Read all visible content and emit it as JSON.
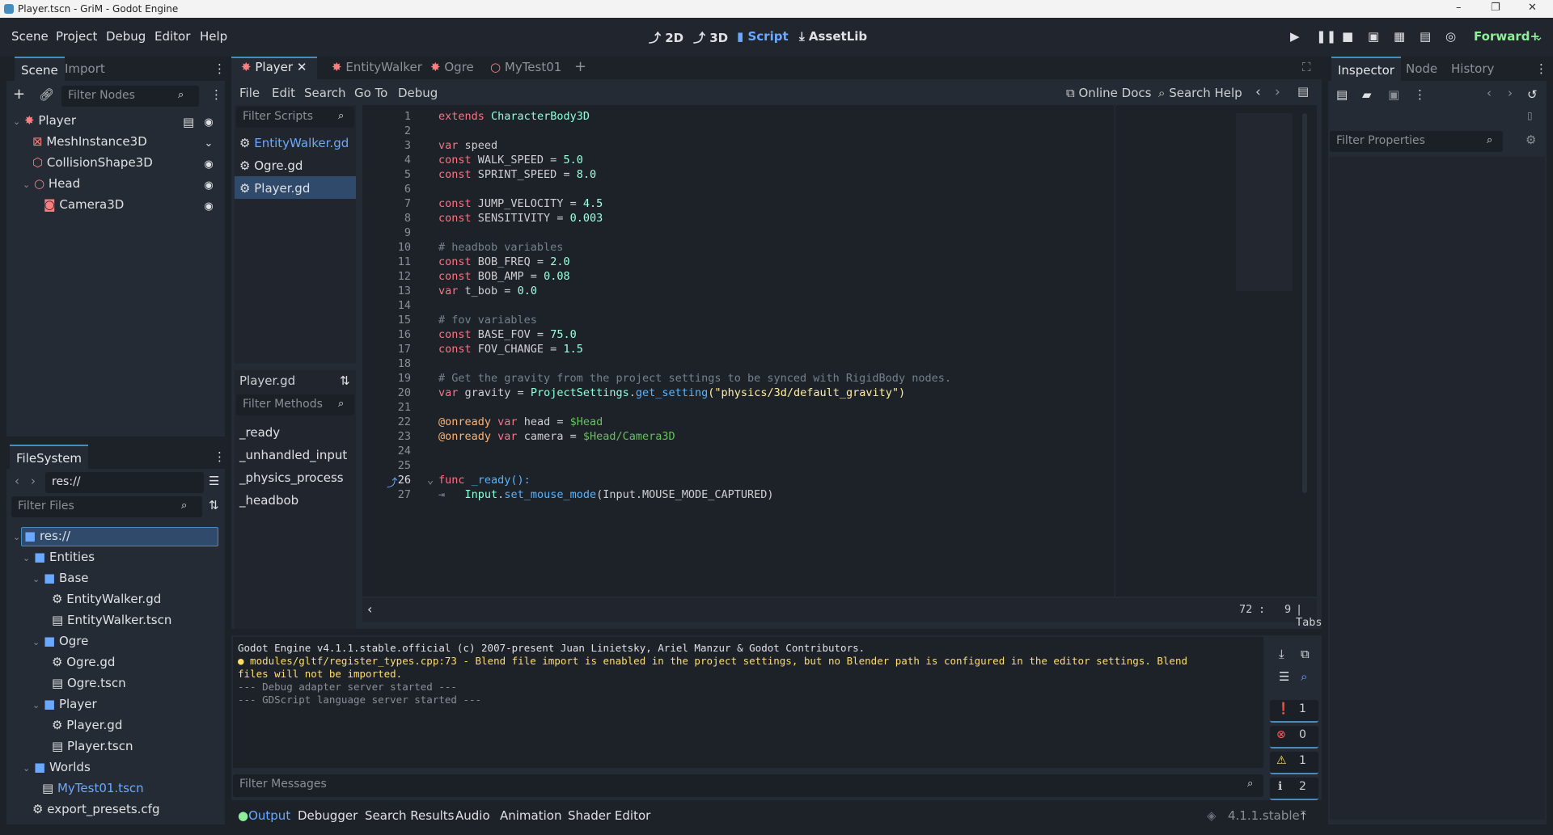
{
  "window": {
    "title": "Player.tscn - GriM - Godot Engine",
    "controls": [
      "–",
      "❐",
      "✕"
    ]
  },
  "menu": {
    "items": [
      "Scene",
      "Project",
      "Debug",
      "Editor",
      "Help"
    ]
  },
  "modes": {
    "items": [
      "2D",
      "3D",
      "Script",
      "AssetLib"
    ],
    "active": "Script"
  },
  "renderer": "Forward+",
  "scene_dock": {
    "tabs": [
      "Scene",
      "Import"
    ],
    "filter_placeholder": "Filter Nodes",
    "nodes": [
      {
        "label": "Player",
        "icon": "character-body-icon",
        "color": "#fc7f7f"
      },
      {
        "label": "MeshInstance3D",
        "icon": "mesh-icon",
        "color": "#fc7f7f"
      },
      {
        "label": "CollisionShape3D",
        "icon": "collision-shape-icon",
        "color": "#fc7f7f"
      },
      {
        "label": "Head",
        "icon": "node3d-icon",
        "color": "#fc7f7f"
      },
      {
        "label": "Camera3D",
        "icon": "camera-icon",
        "color": "#fc7f7f"
      }
    ]
  },
  "filesystem": {
    "tab": "FileSystem",
    "path": "res://",
    "filter_placeholder": "Filter Files",
    "items": [
      {
        "label": "res://",
        "type": "folder"
      },
      {
        "label": "Entities",
        "type": "folder"
      },
      {
        "label": "Base",
        "type": "folder"
      },
      {
        "label": "EntityWalker.gd",
        "type": "script"
      },
      {
        "label": "EntityWalker.tscn",
        "type": "scene"
      },
      {
        "label": "Ogre",
        "type": "folder"
      },
      {
        "label": "Ogre.gd",
        "type": "script"
      },
      {
        "label": "Ogre.tscn",
        "type": "scene"
      },
      {
        "label": "Player",
        "type": "folder"
      },
      {
        "label": "Player.gd",
        "type": "script"
      },
      {
        "label": "Player.tscn",
        "type": "scene"
      },
      {
        "label": "Worlds",
        "type": "folder"
      },
      {
        "label": "MyTest01.tscn",
        "type": "scene"
      },
      {
        "label": "export_presets.cfg",
        "type": "config"
      }
    ]
  },
  "editor_tabs": [
    "Player",
    "EntityWalker",
    "Ogre",
    "MyTest01"
  ],
  "script_menu": [
    "File",
    "Edit",
    "Search",
    "Go To",
    "Debug"
  ],
  "script_toolbar": {
    "online_docs": "Online Docs",
    "search_help": "Search Help"
  },
  "scripts_panel": {
    "filter_placeholder": "Filter Scripts",
    "scripts": [
      "EntityWalker.gd",
      "Ogre.gd",
      "Player.gd"
    ],
    "current": "Player.gd",
    "methods_filter_placeholder": "Filter Methods",
    "methods": [
      "_ready",
      "_unhandled_input",
      "_physics_process",
      "_headbob"
    ]
  },
  "code": {
    "line_numbers": [
      "1",
      "2",
      "3",
      "4",
      "5",
      "6",
      "7",
      "8",
      "9",
      "10",
      "11",
      "12",
      "13",
      "14",
      "15",
      "16",
      "17",
      "18",
      "19",
      "20",
      "21",
      "22",
      "23",
      "24",
      "25",
      "26",
      "27"
    ],
    "line1_kw": "extends",
    "line1_type": "CharacterBody3D",
    "var_kw": "var",
    "const_kw": "const",
    "func_kw": "func",
    "onready": "@onready",
    "speed": "speed",
    "walk_speed": "WALK_SPEED =",
    "walk_speed_val": "5.0",
    "sprint_speed": "SPRINT_SPEED =",
    "sprint_speed_val": "8.0",
    "jump_velocity": "JUMP_VELOCITY =",
    "jump_velocity_val": "4.5",
    "sensitivity": "SENSITIVITY =",
    "sensitivity_val": "0.003",
    "comment_headbob": "# headbob variables",
    "bob_freq": "BOB_FREQ =",
    "bob_freq_val": "2.0",
    "bob_amp": "BOB_AMP =",
    "bob_amp_val": "0.08",
    "t_bob": "t_bob =",
    "t_bob_val": "0.0",
    "comment_fov": "# fov variables",
    "base_fov": "BASE_FOV =",
    "base_fov_val": "75.0",
    "fov_change": "FOV_CHANGE =",
    "fov_change_val": "1.5",
    "comment_gravity": "# Get the gravity from the project settings to be synced with RigidBody nodes.",
    "gravity": "gravity =",
    "project_settings": "ProjectSettings",
    "dot": ".",
    "get_setting": "get_setting",
    "gravity_arg": "(\"physics/3d/default_gravity\")",
    "head_decl": "head =",
    "head_path": "$Head",
    "camera_decl": "camera =",
    "camera_path": "$Head/Camera3D",
    "ready_sig": "_ready():",
    "input": "Input",
    "set_mouse_mode": "set_mouse_mode",
    "mouse_arg": "(Input.MOUSE_MODE_CAPTURED)"
  },
  "status": {
    "line": "72",
    "sep": ":",
    "col": "9",
    "indent": "| Tabs"
  },
  "output": {
    "lines": [
      "Godot Engine v4.1.1.stable.official (c) 2007-present Juan Linietsky, Ariel Manzur & Godot Contributors.",
      "● modules/gltf/register_types.cpp:73 - Blend file import is enabled in the project settings, but no Blender path is configured in the editor settings. Blend",
      "files will not be imported.",
      "--- Debug adapter server started ---",
      "--- GDScript language server started ---"
    ],
    "filter_placeholder": "Filter Messages",
    "counts": {
      "messages": "1",
      "errors": "0",
      "warnings": "1",
      "info": "2"
    }
  },
  "bottom_tabs": [
    "Output",
    "Debugger",
    "Search Results",
    "Audio",
    "Animation",
    "Shader Editor"
  ],
  "version": "4.1.1.stable",
  "inspector": {
    "tabs": [
      "Inspector",
      "Node",
      "History"
    ],
    "filter_placeholder": "Filter Properties"
  }
}
